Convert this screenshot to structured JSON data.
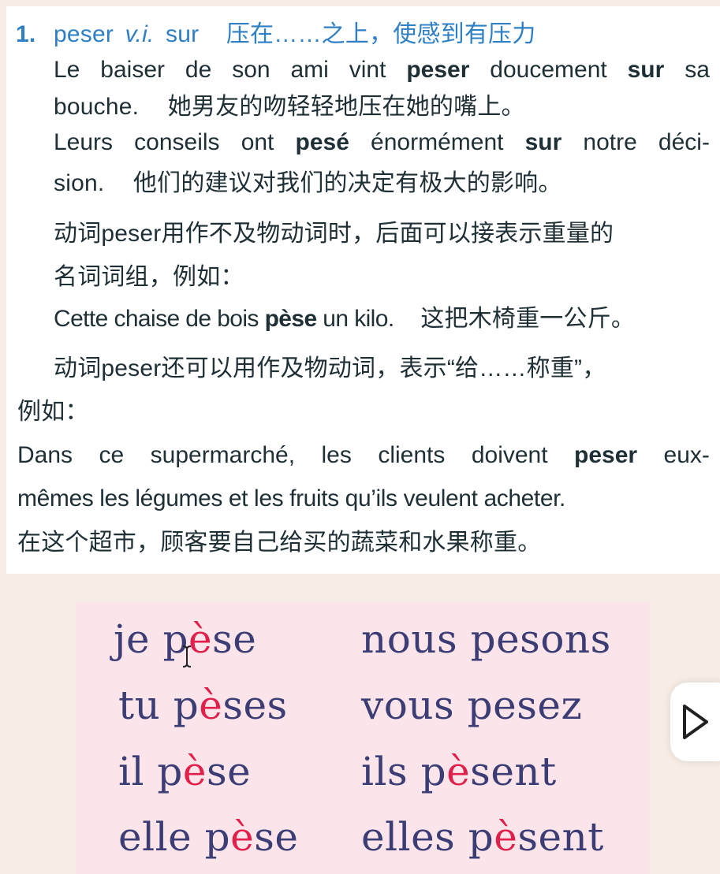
{
  "entry": {
    "number": "1.",
    "headword": "peser",
    "pos": "v.i.",
    "preposition": "sur",
    "gloss": "压在……之上，使感到有压力",
    "examples": [
      {
        "w": [
          "Le",
          "baiser",
          "de",
          "son",
          "ami",
          "vint",
          "peser",
          "doucement",
          "sur",
          "sa"
        ],
        "line2_fr": "bouche.",
        "line2_zh": "她男友的吻轻轻地压在她的嘴上。"
      },
      {
        "w": [
          "Leurs",
          "conseils",
          "ont",
          "pesé",
          "énormément",
          "sur",
          "notre",
          "déci-"
        ],
        "line2_fr": "sion.",
        "line2_zh": "他们的建议对我们的决定有极大的影响。"
      }
    ]
  },
  "notes": {
    "intransitive_1": "动词peser用作不及物动词时，后面可以接表示重量的",
    "intransitive_2": "名词词组，例如：",
    "example3_fr_a": "Cette chaise de bois ",
    "example3_fr_b": "pèse",
    "example3_fr_c": " un kilo.",
    "example3_zh": "这把木椅重一公斤。",
    "transitive_1": "动词peser还可以用作及物动词，表示“给……称重”，",
    "transitive_2": "例如：",
    "example4_w": [
      "Dans",
      "ce",
      "supermarché,",
      "les",
      "clients",
      "doivent",
      "peser",
      "eux-"
    ],
    "example4_line2": "mêmes les légumes et les fruits qu’ils veulent acheter.",
    "example4_zh": "在这个超市，顾客要自己给买的蔬菜和水果称重。"
  },
  "conjugation": {
    "rows": [
      {
        "l_pron": "je",
        "l_a": "p",
        "l_acc": "è",
        "l_b": "se",
        "r_pron": "nous",
        "r_a": "pesons",
        "r_acc": "",
        "r_b": ""
      },
      {
        "l_pron": "tu",
        "l_a": "p",
        "l_acc": "è",
        "l_b": "ses",
        "r_pron": "vous",
        "r_a": "pesez",
        "r_acc": "",
        "r_b": ""
      },
      {
        "l_pron": "il",
        "l_a": "p",
        "l_acc": "è",
        "l_b": "se",
        "r_pron": "ils",
        "r_a": "p",
        "r_acc": "è",
        "r_b": "sent"
      },
      {
        "l_pron": "elle",
        "l_a": "p",
        "l_acc": "è",
        "l_b": "se",
        "r_pron": "elles",
        "r_a": "p",
        "r_acc": "è",
        "r_b": "sent"
      }
    ],
    "accent_color": "#e0204a",
    "text_color": "#3b3d74"
  },
  "icons": {
    "cursor": "text-cursor-icon",
    "player": "play-icon"
  }
}
